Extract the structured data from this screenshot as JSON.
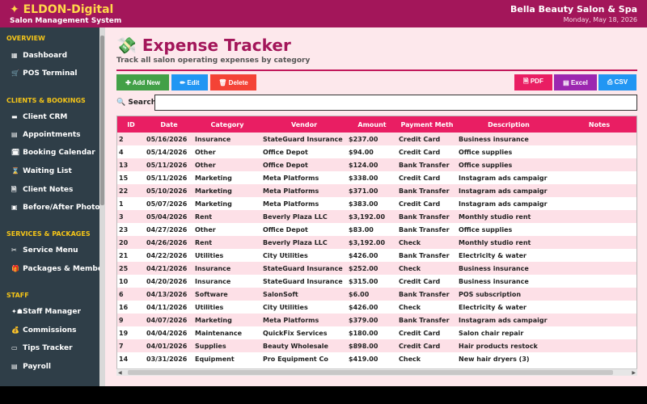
{
  "header": {
    "brand": "✦ ELDON-Digital",
    "subtitle": "Salon Management System",
    "salon": "Bella Beauty Salon & Spa",
    "date": "Monday, May 18, 2026"
  },
  "sidebar": {
    "sections": [
      "OVERVIEW",
      "CLIENTS & BOOKINGS",
      "SERVICES & PACKAGES",
      "STAFF"
    ],
    "items": [
      {
        "label": "Dashboard",
        "icon": "▦"
      },
      {
        "label": "POS Terminal",
        "icon": "🛒"
      },
      {
        "label": "Client CRM",
        "icon": "▬"
      },
      {
        "label": "Appointments",
        "icon": "▤"
      },
      {
        "label": "Booking Calendar",
        "icon": "🗓"
      },
      {
        "label": "Waiting List",
        "icon": "⌛"
      },
      {
        "label": "Client Notes",
        "icon": "🗎"
      },
      {
        "label": "Before/After Photos",
        "icon": "▣"
      },
      {
        "label": "Service Menu",
        "icon": "✂"
      },
      {
        "label": "Packages & Membersh",
        "icon": "🎁"
      },
      {
        "label": "Staff Manager",
        "icon": "✦☗"
      },
      {
        "label": "Commissions",
        "icon": "💰"
      },
      {
        "label": "Tips Tracker",
        "icon": "▭"
      },
      {
        "label": "Payroll",
        "icon": "▤"
      }
    ]
  },
  "page": {
    "title": "💸 Expense Tracker",
    "subtitle": "Track all salon operating expenses by category"
  },
  "toolbar": {
    "add": "✚ Add New",
    "edit": "✏ Edit",
    "delete": "🗑 Delete",
    "pdf": "🗎 PDF",
    "excel": "▤ Excel",
    "csv": "⎙ CSV"
  },
  "search": {
    "label": "🔍 Search:",
    "value": ""
  },
  "table": {
    "columns": [
      "ID",
      "Date",
      "Category",
      "Vendor",
      "Amount",
      "Payment Meth",
      "Description",
      "Notes"
    ],
    "rows": [
      [
        "2",
        "05/16/2026",
        "Insurance",
        "StateGuard Insurance",
        "$237.00",
        "Credit Card",
        "Business insurance",
        ""
      ],
      [
        "4",
        "05/14/2026",
        "Other",
        "Office Depot",
        "$94.00",
        "Credit Card",
        "Office supplies",
        ""
      ],
      [
        "13",
        "05/11/2026",
        "Other",
        "Office Depot",
        "$124.00",
        "Bank Transfer",
        "Office supplies",
        ""
      ],
      [
        "15",
        "05/11/2026",
        "Marketing",
        "Meta Platforms",
        "$338.00",
        "Credit Card",
        "Instagram ads campaigr",
        ""
      ],
      [
        "22",
        "05/10/2026",
        "Marketing",
        "Meta Platforms",
        "$371.00",
        "Bank Transfer",
        "Instagram ads campaigr",
        ""
      ],
      [
        "1",
        "05/07/2026",
        "Marketing",
        "Meta Platforms",
        "$383.00",
        "Credit Card",
        "Instagram ads campaigr",
        ""
      ],
      [
        "3",
        "05/04/2026",
        "Rent",
        "Beverly Plaza LLC",
        "$3,192.00",
        "Bank Transfer",
        "Monthly studio rent",
        ""
      ],
      [
        "23",
        "04/27/2026",
        "Other",
        "Office Depot",
        "$83.00",
        "Bank Transfer",
        "Office supplies",
        ""
      ],
      [
        "20",
        "04/26/2026",
        "Rent",
        "Beverly Plaza LLC",
        "$3,192.00",
        "Check",
        "Monthly studio rent",
        ""
      ],
      [
        "21",
        "04/22/2026",
        "Utilities",
        "City Utilities",
        "$426.00",
        "Bank Transfer",
        "Electricity & water",
        ""
      ],
      [
        "25",
        "04/21/2026",
        "Insurance",
        "StateGuard Insurance",
        "$252.00",
        "Check",
        "Business insurance",
        ""
      ],
      [
        "10",
        "04/20/2026",
        "Insurance",
        "StateGuard Insurance",
        "$315.00",
        "Credit Card",
        "Business insurance",
        ""
      ],
      [
        "6",
        "04/13/2026",
        "Software",
        "SalonSoft",
        "$6.00",
        "Bank Transfer",
        "POS subscription",
        ""
      ],
      [
        "16",
        "04/11/2026",
        "Utilities",
        "City Utilities",
        "$426.00",
        "Check",
        "Electricity & water",
        ""
      ],
      [
        "9",
        "04/07/2026",
        "Marketing",
        "Meta Platforms",
        "$379.00",
        "Bank Transfer",
        "Instagram ads campaigr",
        ""
      ],
      [
        "19",
        "04/04/2026",
        "Maintenance",
        "QuickFix Services",
        "$180.00",
        "Credit Card",
        "Salon chair repair",
        ""
      ],
      [
        "7",
        "04/01/2026",
        "Supplies",
        "Beauty Wholesale",
        "$898.00",
        "Credit Card",
        "Hair products restock",
        ""
      ],
      [
        "14",
        "03/31/2026",
        "Equipment",
        "Pro Equipment Co",
        "$419.00",
        "Check",
        "New hair dryers (3)",
        ""
      ]
    ]
  }
}
